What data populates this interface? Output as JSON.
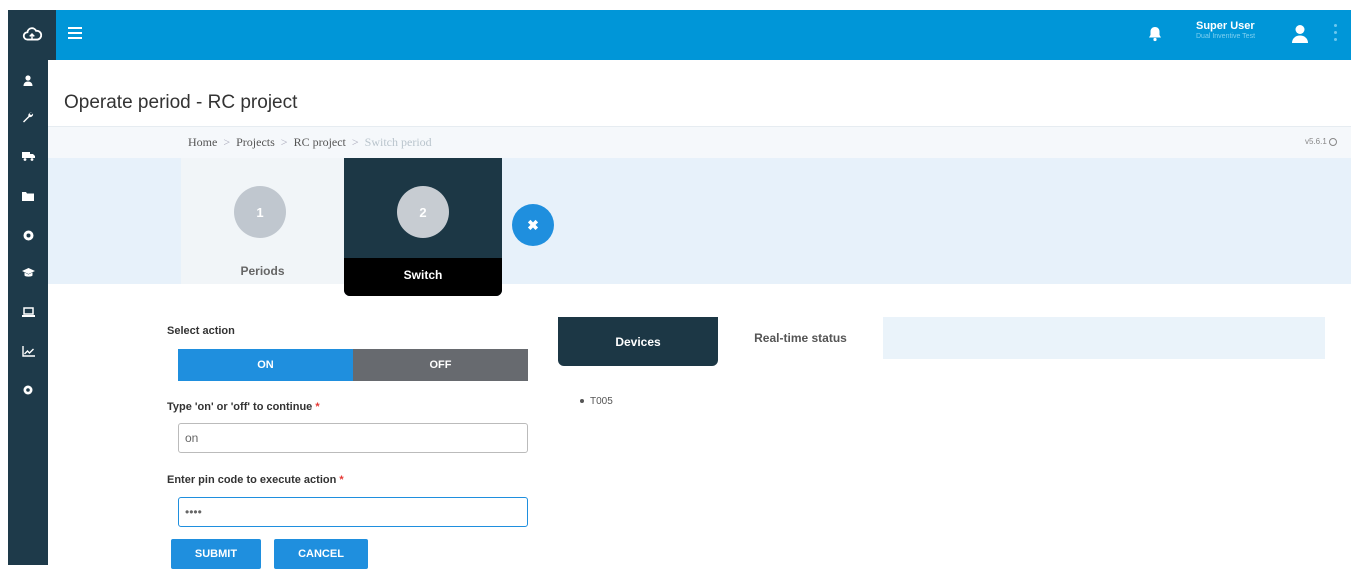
{
  "header": {
    "user_name": "Super User",
    "user_org": "Dual Inventive Test"
  },
  "sidebar": {
    "items": [
      {
        "icon": "user-icon"
      },
      {
        "icon": "wrench-icon"
      },
      {
        "icon": "truck-icon"
      },
      {
        "icon": "folder-icon"
      },
      {
        "icon": "globe-icon"
      },
      {
        "icon": "graduation-cap-icon"
      },
      {
        "icon": "laptop-icon"
      },
      {
        "icon": "chart-line-icon"
      },
      {
        "icon": "gear-icon"
      }
    ]
  },
  "page": {
    "title": "Operate period - RC project"
  },
  "breadcrumb": {
    "items": [
      "Home",
      "Projects",
      "RC project"
    ],
    "current": "Switch period",
    "version": "v5.6.1"
  },
  "wizard": {
    "steps": [
      {
        "number": "1",
        "label": "Periods"
      },
      {
        "number": "2",
        "label": "Switch"
      }
    ],
    "close_symbol": "✖"
  },
  "form": {
    "select_action_label": "Select action",
    "on_label": "ON",
    "off_label": "OFF",
    "type_label": "Type 'on' or 'off' to continue",
    "type_value": "on",
    "pin_label": "Enter pin code to execute action",
    "pin_value": "••••",
    "required_mark": "*",
    "submit_label": "SUBMIT",
    "cancel_label": "CANCEL"
  },
  "tabs": {
    "devices_label": "Devices",
    "realtime_label": "Real-time status"
  },
  "devices": [
    "T005"
  ],
  "colors": {
    "header_blue": "#0096d8",
    "sidebar_dark": "#1e3a4a",
    "accent_blue": "#1f8fde",
    "off_gray": "#676a6f"
  }
}
